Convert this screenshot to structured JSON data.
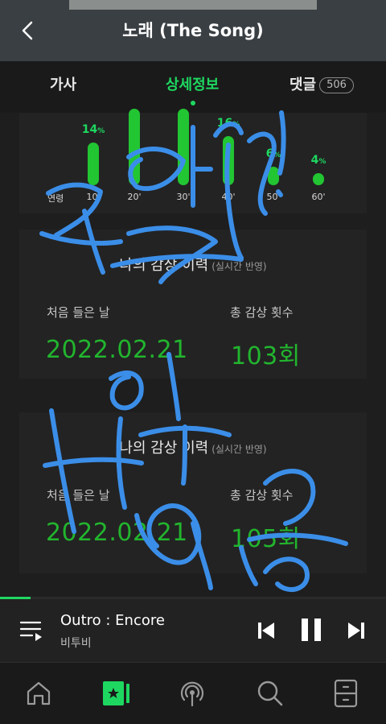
{
  "header": {
    "title": "노래 (The Song)"
  },
  "tabs": [
    {
      "label": "가사"
    },
    {
      "label": "상세정보"
    },
    {
      "label": "댓글",
      "count": "506"
    }
  ],
  "age_chart": {
    "axis_label": "연령",
    "categories": [
      "10'",
      "20'",
      "30'",
      "40'",
      "50'",
      "60'"
    ],
    "percents": [
      14,
      null,
      null,
      16,
      6,
      4
    ],
    "pct_labels": [
      "14",
      "",
      "",
      "16",
      "6",
      "4"
    ],
    "pct_unit": "%"
  },
  "history_cards": [
    {
      "title": "나의 감상 이력",
      "subtitle": "(실시간 반영)",
      "first_label": "처음 들은 날",
      "first_value": "2022.02.21",
      "count_label": "총 감상 횟수",
      "count_value": "103회"
    },
    {
      "title": "나의 감상 이력",
      "subtitle": "(실시간 반영)",
      "first_label": "처음 들은 날",
      "first_value": "2022.02.21",
      "count_label": "총 감상 횟수",
      "count_value": "105회"
    }
  ],
  "player": {
    "song": "Outro : Encore",
    "artist": "비투비",
    "progress": 0.08
  },
  "colors": {
    "accent": "#1ed760",
    "bar": "#22c532",
    "value_text": "#22b52e",
    "scribble": "#3b8ee8"
  },
  "icons": [
    "back-icon",
    "playlist-icon",
    "previous-icon",
    "pause-icon",
    "next-icon",
    "home-icon",
    "mymusic-icon",
    "podcast-icon",
    "search-icon",
    "storage-icon"
  ]
}
